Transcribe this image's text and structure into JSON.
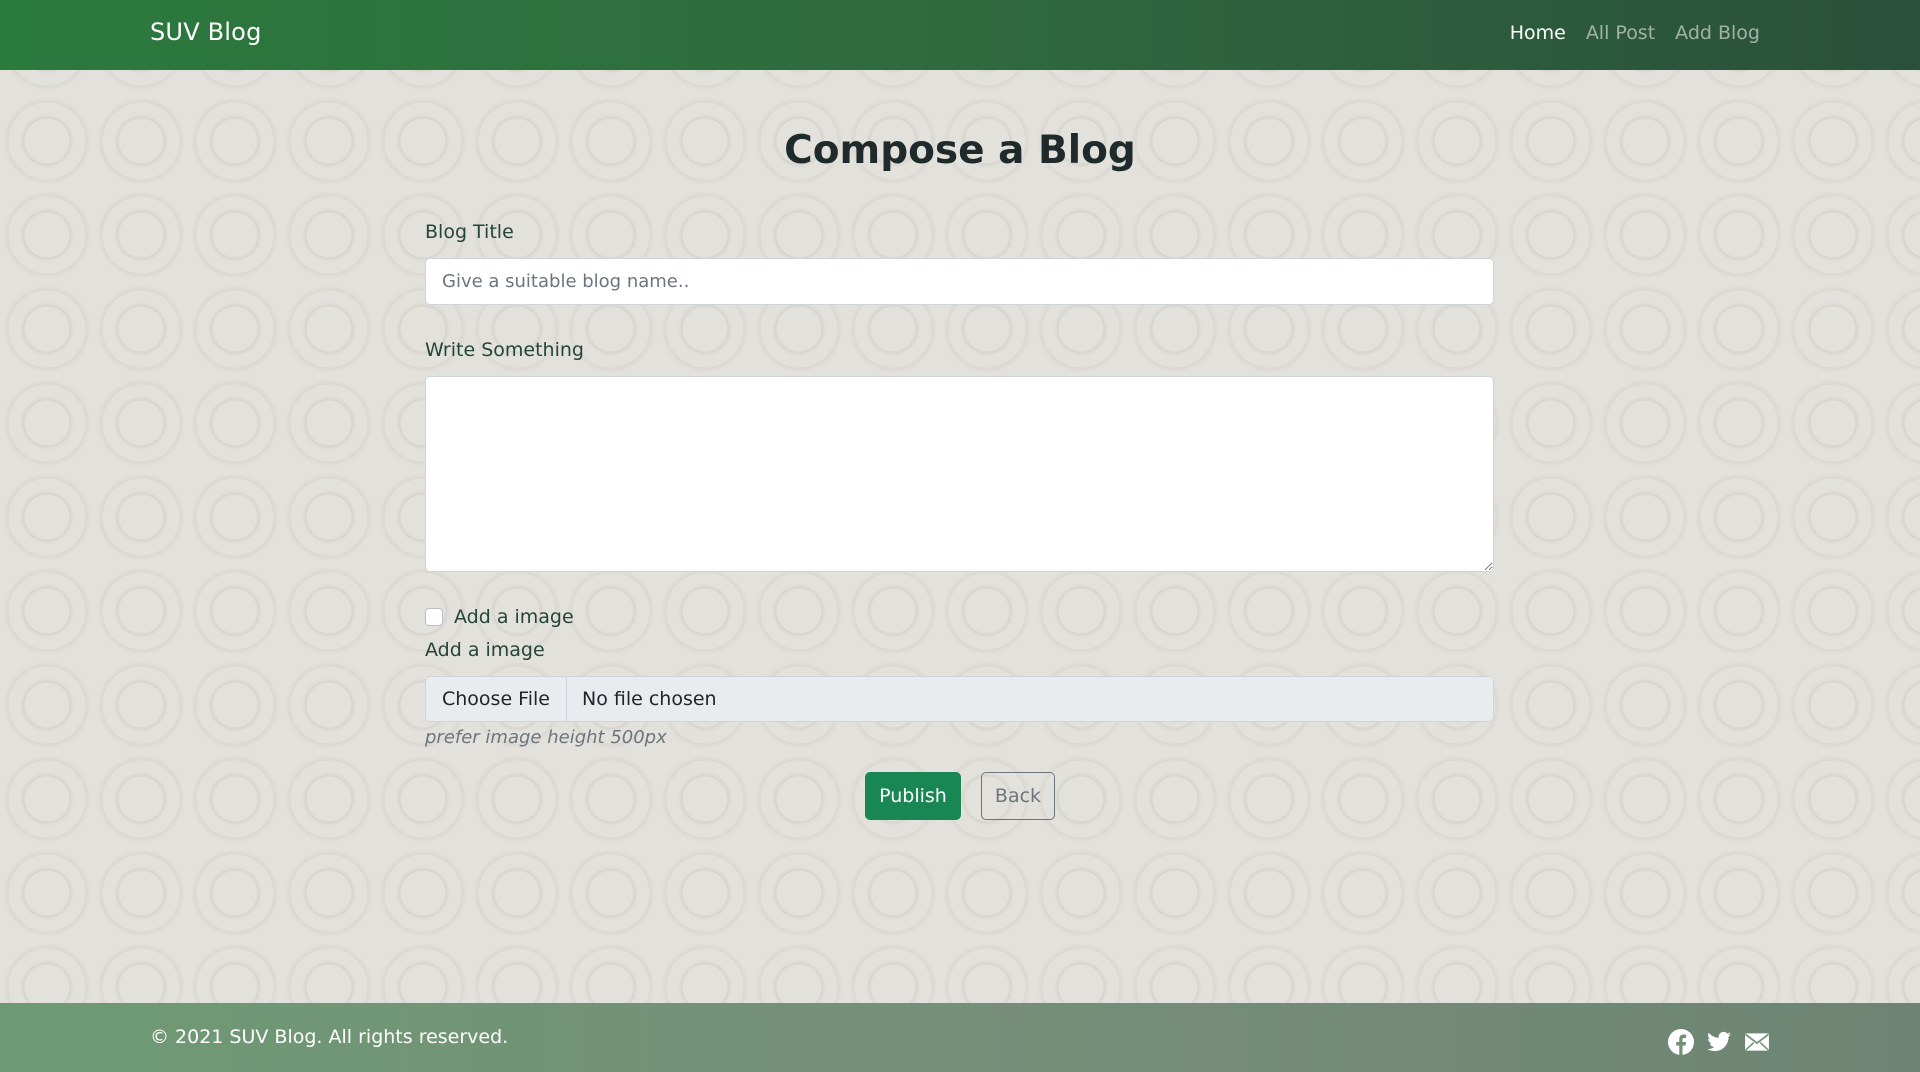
{
  "navbar": {
    "brand": "SUV Blog",
    "links": [
      {
        "label": "Home",
        "active": true
      },
      {
        "label": "All Post",
        "active": false
      },
      {
        "label": "Add Blog",
        "active": false
      }
    ]
  },
  "main": {
    "title": "Compose a Blog",
    "blog_title_label": "Blog Title",
    "blog_title_placeholder": "Give a suitable blog name..",
    "blog_title_value": "",
    "body_label": "Write Something",
    "body_value": "",
    "add_image_checkbox_label": "Add a image",
    "add_image_checked": false,
    "image_label": "Add a image",
    "file_button_label": "Choose File",
    "file_status": "No file chosen",
    "hint": "prefer image height 500px",
    "publish_label": "Publish",
    "back_label": "Back"
  },
  "footer": {
    "copyright": "© 2021 SUV Blog. All rights reserved.",
    "social_icons": [
      "facebook-icon",
      "twitter-icon",
      "mail-icon"
    ]
  },
  "colors": {
    "navbar_gradient_start": "#2b7a3e",
    "navbar_gradient_end": "#2b4f3b",
    "footer": "#738f76",
    "primary_button": "#198754",
    "background": "#e3e1dc"
  }
}
